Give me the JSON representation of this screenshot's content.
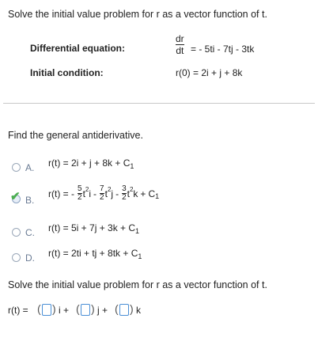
{
  "problem": {
    "title": "Solve the initial value problem for r as a vector function of t.",
    "diff_eq_label": "Differential equation:",
    "diff_eq_num": "dr",
    "diff_eq_den": "dt",
    "diff_eq_rhs": "= - 5ti - 7tj - 3tk",
    "init_label": "Initial condition:",
    "init_value": "r(0) = 2i + j + 8k"
  },
  "part1": {
    "prompt": "Find the general antiderivative.",
    "options": [
      {
        "letter": "A.",
        "text": "r(t) = 2i + j + 8k + C",
        "sub": "1",
        "selected": false
      },
      {
        "letter": "B.",
        "prefix": "r(t) = -",
        "terms": [
          {
            "num": "5",
            "den": "2",
            "var": "t",
            "pow": "2",
            "unit": "i",
            "sep": "-"
          },
          {
            "num": "7",
            "den": "2",
            "var": "t",
            "pow": "2",
            "unit": "j",
            "sep": "-"
          },
          {
            "num": "3",
            "den": "2",
            "var": "t",
            "pow": "2",
            "unit": "k",
            "sep": "+"
          }
        ],
        "tail": "C",
        "sub": "1",
        "selected": true
      },
      {
        "letter": "C.",
        "text": "r(t) = 5i + 7j + 3k + C",
        "sub": "1",
        "selected": false
      },
      {
        "letter": "D.",
        "text": "r(t) = 2ti + tj + 8tk + C",
        "sub": "1",
        "selected": false
      }
    ]
  },
  "part2": {
    "prompt": "Solve the initial value problem for r as a vector function of t.",
    "lead": "r(t) =",
    "i": "i +",
    "j": "j +",
    "k": "k"
  }
}
